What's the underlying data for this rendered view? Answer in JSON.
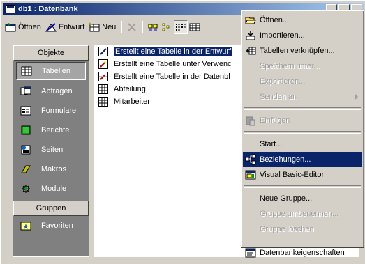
{
  "window": {
    "title": "db1 : Datenbank"
  },
  "toolbar": {
    "open_label": "Öffnen",
    "design_label": "Entwurf",
    "new_label": "Neu"
  },
  "objects_bar": {
    "header": "Objekte",
    "items": [
      {
        "label": "Tabellen"
      },
      {
        "label": "Abfragen"
      },
      {
        "label": "Formulare"
      },
      {
        "label": "Berichte"
      },
      {
        "label": "Seiten"
      },
      {
        "label": "Makros"
      },
      {
        "label": "Module"
      }
    ],
    "groups_header": "Gruppen",
    "groups": [
      {
        "label": "Favoriten"
      }
    ]
  },
  "list": {
    "items": [
      {
        "label": "Erstellt eine Tabelle in der Entwurf"
      },
      {
        "label": "Erstellt eine Tabelle unter Verwenc"
      },
      {
        "label": "Erstellt eine Tabelle in der Datenbl"
      },
      {
        "label": "Abteilung"
      },
      {
        "label": "Mitarbeiter"
      }
    ]
  },
  "context_menu": {
    "items": [
      {
        "label": "Öffnen..."
      },
      {
        "label": "Importieren..."
      },
      {
        "label": "Tabellen verknüpfen..."
      },
      {
        "label": "Speichern unter..."
      },
      {
        "label": "Exportieren..."
      },
      {
        "label": "Senden an"
      },
      {
        "label": "Einfügen"
      },
      {
        "label": "Start..."
      },
      {
        "label": "Beziehungen..."
      },
      {
        "label": "Visual Basic-Editor"
      },
      {
        "label": "Neue Gruppe..."
      },
      {
        "label": "Gruppe umbenennen..."
      },
      {
        "label": "Gruppe löschen"
      },
      {
        "label": "Datenbankeigenschaften"
      }
    ]
  },
  "colors": {
    "selection": "#0a246a",
    "face": "#d4d0c8",
    "objbar": "#808080"
  }
}
